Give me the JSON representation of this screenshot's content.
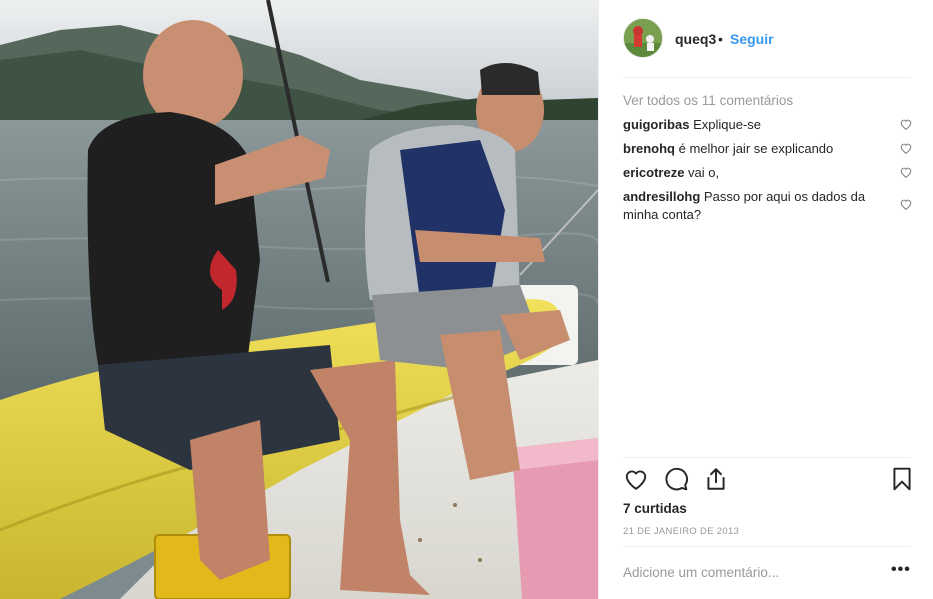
{
  "post": {
    "username": "queq3",
    "separator": "•",
    "follow_label": "Seguir",
    "view_all_comments": "Ver todos os 11 comentários",
    "comments": [
      {
        "user": "guigoribas",
        "text": "Explique-se"
      },
      {
        "user": "brenohq",
        "text": "é melhor jair se explicando"
      },
      {
        "user": "ericotreze",
        "text": "vai o,"
      },
      {
        "user": "andresillohg",
        "text": "Passo por aqui os dados da minha conta?"
      }
    ],
    "likes_text": "7 curtidas",
    "date": "21 DE JANEIRO DE 2013",
    "add_comment_placeholder": "Adicione um comentário...",
    "more_options": "•••"
  },
  "icons": {
    "like": "heart-icon",
    "comment": "speech-bubble-icon",
    "share": "share-icon",
    "save": "bookmark-icon",
    "comment_like": "small-heart-icon"
  },
  "colors": {
    "link_blue": "#3897f0",
    "text": "#262626",
    "muted": "#999999",
    "divider": "#efefef"
  }
}
